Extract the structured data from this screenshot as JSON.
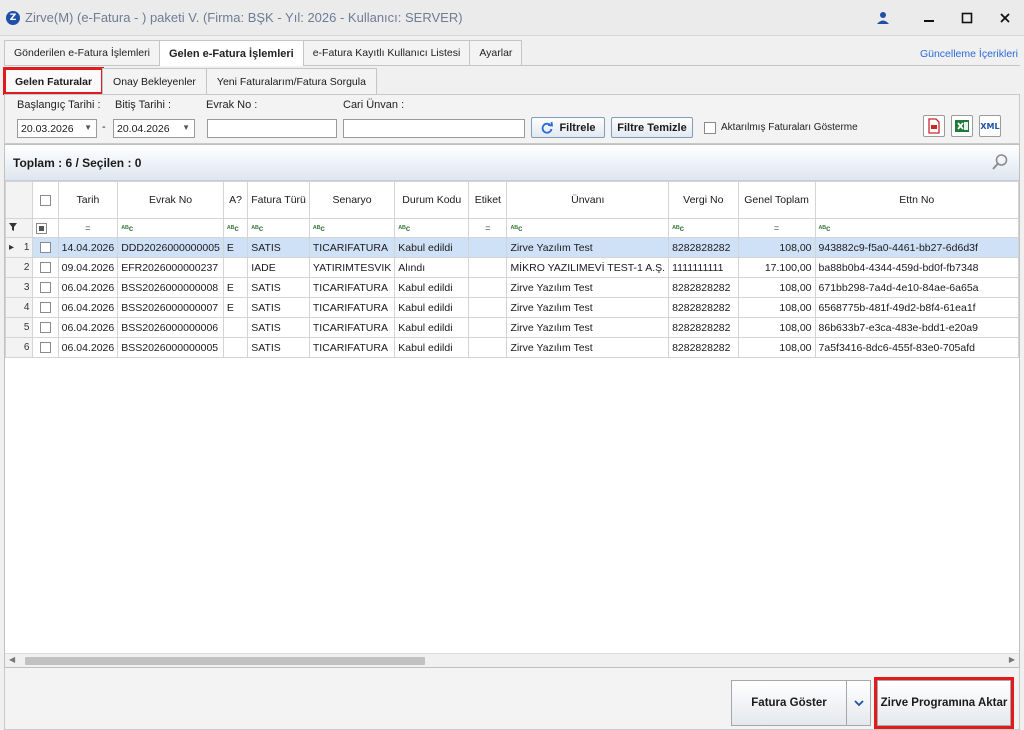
{
  "window": {
    "title": "Zirve(M)  (e-Fatura - ) paketi V. (Firma: BŞK - Yıl: 2026 - Kullanıcı: SERVER)",
    "logo_letter": "Z"
  },
  "tabs_main": [
    {
      "label": "Gönderilen e-Fatura İşlemleri",
      "active": false
    },
    {
      "label": "Gelen e-Fatura İşlemleri",
      "active": true
    },
    {
      "label": "e-Fatura Kayıtlı Kullanıcı Listesi",
      "active": false
    },
    {
      "label": "Ayarlar",
      "active": false
    }
  ],
  "update_link": "Güncelleme İçerikleri",
  "tabs_sub": [
    {
      "label": "Gelen Faturalar",
      "active": true
    },
    {
      "label": "Onay Bekleyenler",
      "active": false
    },
    {
      "label": "Yeni Faturalarım/Fatura Sorgula",
      "active": false
    }
  ],
  "filters": {
    "start_label": "Başlangıç Tarihi :",
    "start_value": "20.03.2026",
    "end_label": "Bitiş Tarihi :",
    "end_value": "20.04.2026",
    "dash": "-",
    "doc_label": "Evrak No :",
    "doc_value": "",
    "cari_label": "Cari Ünvan :",
    "cari_value": "",
    "filter_btn": "Filtrele",
    "clear_btn": "Filtre Temizle",
    "show_transferred_label": "Aktarılmış Faturaları Gösterme",
    "show_transferred_checked": false,
    "export_icons": [
      "pdf-icon",
      "excel-icon",
      "xml-icon"
    ],
    "xml_text": "XML"
  },
  "grid": {
    "summary": "Toplam : 6 / Seçilen : 0",
    "columns": [
      "Tarih",
      "Evrak No",
      "A?",
      "Fatura Türü",
      "Senaryo",
      "Durum Kodu",
      "Etiket",
      "Ünvanı",
      "Vergi No",
      "Genel Toplam",
      "Ettn No"
    ],
    "filter_row": [
      "=",
      "abc",
      "abc",
      "abc",
      "abc",
      "abc",
      "=",
      "abc",
      "abc",
      "=",
      "abc"
    ],
    "filter_icon_text": "ᴬᴮc",
    "rows": [
      {
        "num": "1",
        "selected": true,
        "cells": [
          "14.04.2026",
          "DDD2026000000005",
          "E",
          "SATIS",
          "TICARIFATURA",
          "Kabul edildi",
          "",
          "Zirve Yazılım Test",
          "8282828282",
          "108,00",
          "943882c9-f5a0-4461-bb27-6d6d3f"
        ]
      },
      {
        "num": "2",
        "selected": false,
        "cells": [
          "09.04.2026",
          "EFR2026000000237",
          "",
          "IADE",
          "YATIRIMTESVIK",
          "Alındı",
          "",
          "MİKRO YAZILIMEVİ TEST-1 A.Ş.",
          "1111111111",
          "17.100,00",
          "ba88b0b4-4344-459d-bd0f-fb7348"
        ]
      },
      {
        "num": "3",
        "selected": false,
        "cells": [
          "06.04.2026",
          "BSS2026000000008",
          "E",
          "SATIS",
          "TICARIFATURA",
          "Kabul edildi",
          "",
          "Zirve Yazılım Test",
          "8282828282",
          "108,00",
          "671bb298-7a4d-4e10-84ae-6a65a"
        ]
      },
      {
        "num": "4",
        "selected": false,
        "cells": [
          "06.04.2026",
          "BSS2026000000007",
          "E",
          "SATIS",
          "TICARIFATURA",
          "Kabul edildi",
          "",
          "Zirve Yazılım Test",
          "8282828282",
          "108,00",
          "6568775b-481f-49d2-b8f4-61ea1f"
        ]
      },
      {
        "num": "5",
        "selected": false,
        "cells": [
          "06.04.2026",
          "BSS2026000000006",
          "",
          "SATIS",
          "TICARIFATURA",
          "Kabul edildi",
          "",
          "Zirve Yazılım Test",
          "8282828282",
          "108,00",
          "86b633b7-e3ca-483e-bdd1-e20a9"
        ]
      },
      {
        "num": "6",
        "selected": false,
        "cells": [
          "06.04.2026",
          "BSS2026000000005",
          "",
          "SATIS",
          "TICARIFATURA",
          "Kabul edildi",
          "",
          "Zirve Yazılım Test",
          "8282828282",
          "108,00",
          "7a5f3416-8dc6-455f-83e0-705afd"
        ]
      }
    ]
  },
  "bottom": {
    "show_invoice": "Fatura Göster",
    "transfer": "Zirve Programına Aktar"
  },
  "colors": {
    "accent_blue": "#2a6ad9",
    "highlight_red": "#e11b1b",
    "selected_row": "#cfe1f6"
  }
}
